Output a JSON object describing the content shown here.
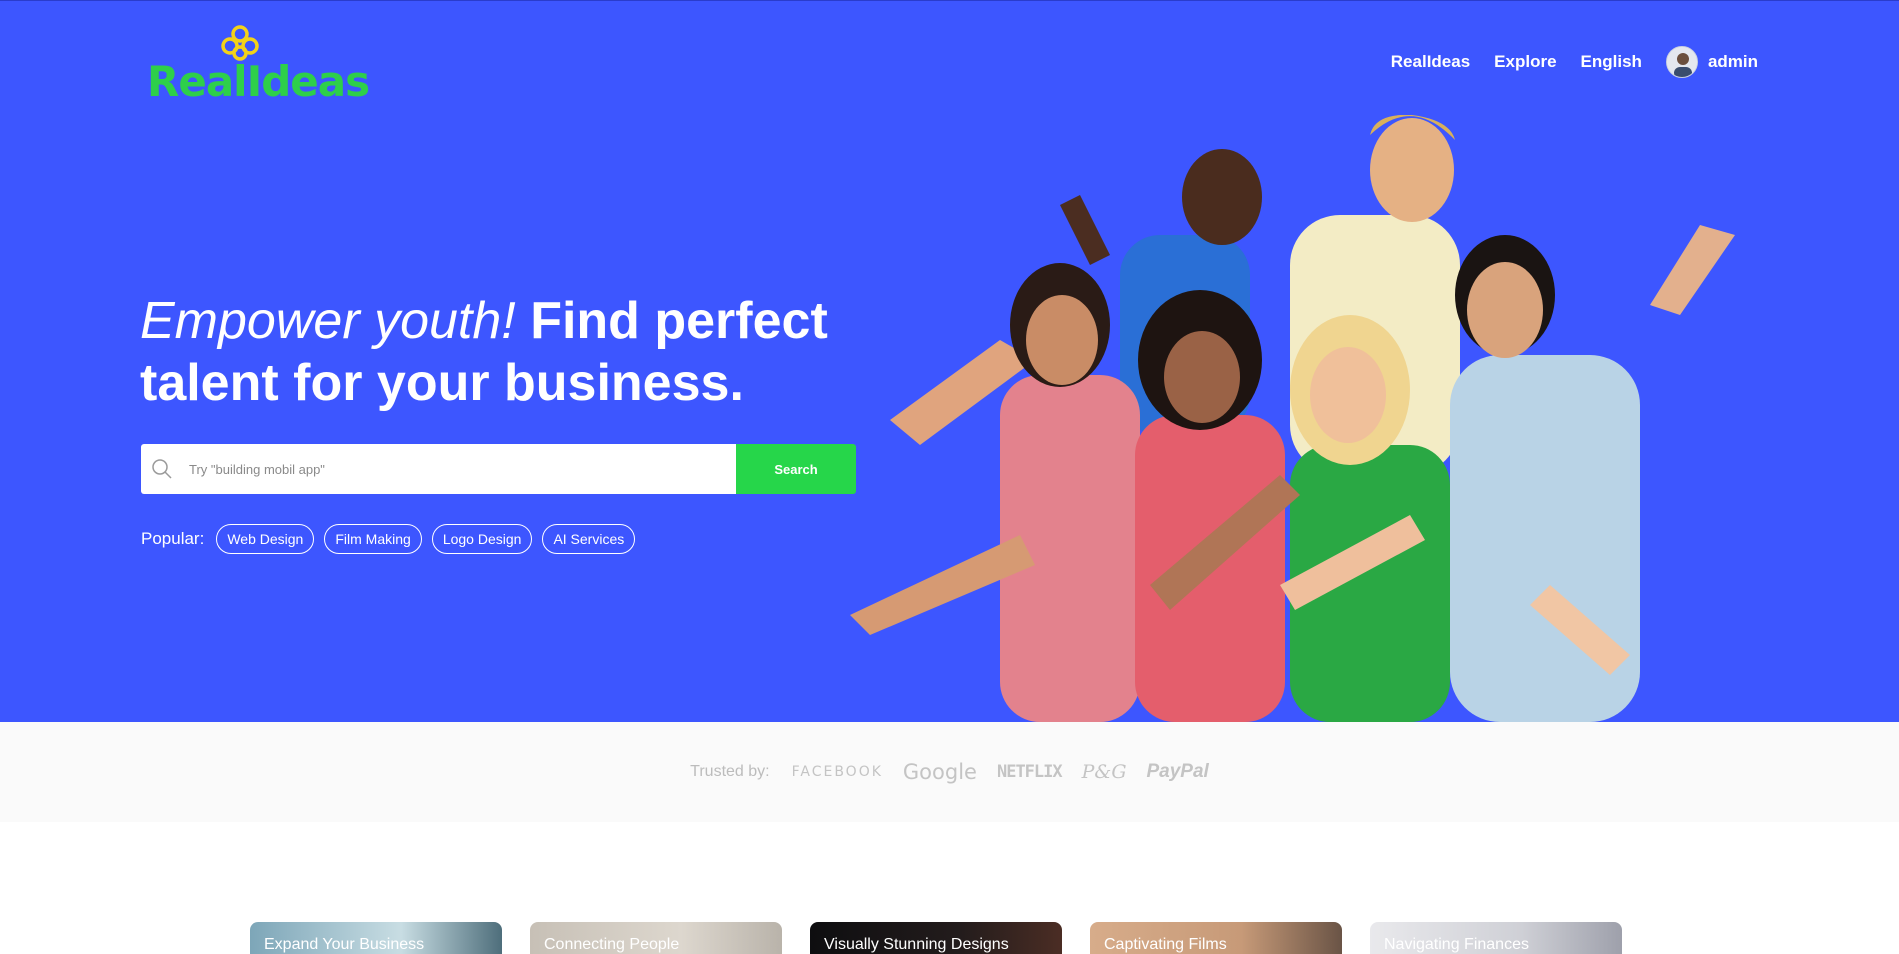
{
  "brand": {
    "name": "RealIdeas"
  },
  "nav": {
    "items": [
      "RealIdeas",
      "Explore",
      "English"
    ],
    "user": "admin"
  },
  "hero": {
    "headline_italic": "Empower youth!",
    "headline_bold": "Find perfect talent for your business.",
    "search": {
      "placeholder": "Try \"building mobil app\"",
      "button": "Search"
    },
    "popular_label": "Popular:",
    "popular_tags": [
      "Web Design",
      "Film Making",
      "Logo Design",
      "AI Services"
    ]
  },
  "trusted": {
    "label": "Trusted by:",
    "brands": [
      "FACEBOOK",
      "Google",
      "NETFLIX",
      "P&G",
      "PayPal"
    ]
  },
  "cards": [
    {
      "title": "Expand Your Business"
    },
    {
      "title": "Connecting People"
    },
    {
      "title": "Visually Stunning Designs"
    },
    {
      "title": "Captivating Films"
    },
    {
      "title": "Navigating Finances"
    }
  ],
  "colors": {
    "hero_bg": "#3d56ff",
    "accent_green": "#26d64a",
    "logo_green": "#2ecf4a",
    "logo_yellow": "#f2d21a"
  }
}
